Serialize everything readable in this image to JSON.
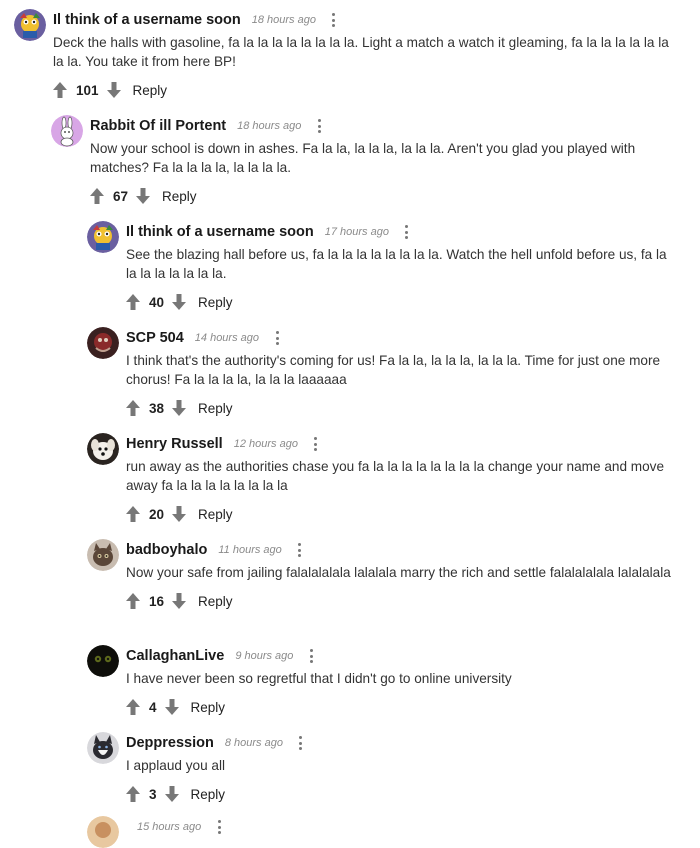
{
  "comments": [
    {
      "username": "Il think of a username soon",
      "time": "18 hours ago",
      "text": "Deck the halls with gasoline, fa la la la la la la la la. Light a match a watch it gleaming, fa la la la la la la la la. You take it from here BP!",
      "votes": "101",
      "reply_label": "Reply",
      "avatar": "mascot-avatar"
    },
    {
      "username": "Rabbit Of ill Portent",
      "time": "18 hours ago",
      "text": "Now your school is down in ashes. Fa la la, la la la, la la la. Aren't you glad you played with matches? Fa la la la la, la la la la.",
      "votes": "67",
      "reply_label": "Reply",
      "avatar": "rabbit-avatar"
    },
    {
      "username": "Il think of a username soon",
      "time": "17 hours ago",
      "text": "See the blazing hall before us, fa la la la la la la la la. Watch the hell unfold before us, fa la la la la la la la la.",
      "votes": "40",
      "reply_label": "Reply",
      "avatar": "mascot-avatar"
    },
    {
      "username": "SCP 504",
      "time": "14 hours ago",
      "text": "I think that's the authority's coming for us! Fa la la, la la la, la la la. Time for just one more chorus! Fa la la la la, la la la laaaaaa",
      "votes": "38",
      "reply_label": "Reply",
      "avatar": "scp-avatar"
    },
    {
      "username": "Henry Russell",
      "time": "12 hours ago",
      "text": "run away as the authorities chase you fa la la la la la la la la change your name and move away fa la la la la la la la la",
      "votes": "20",
      "reply_label": "Reply",
      "avatar": "dog-avatar"
    },
    {
      "username": "badboyhalo",
      "time": "11 hours ago",
      "text": "Now your safe from jailing falalalalala lalalala marry the rich and settle falalalalala lalalalala",
      "votes": "16",
      "reply_label": "Reply",
      "avatar": "cat-avatar"
    },
    {
      "username": "CallaghanLive",
      "time": "9 hours ago",
      "text": "I have never been so regretful that I didn't go to online university",
      "votes": "4",
      "reply_label": "Reply",
      "avatar": "eyes-avatar"
    },
    {
      "username": "Deppression",
      "time": "8 hours ago",
      "text": "I applaud you all",
      "votes": "3",
      "reply_label": "Reply",
      "avatar": "husky-avatar"
    },
    {
      "username": "",
      "time": "15 hours ago",
      "text": "",
      "votes": "",
      "reply_label": "",
      "avatar": "partial-avatar"
    }
  ]
}
